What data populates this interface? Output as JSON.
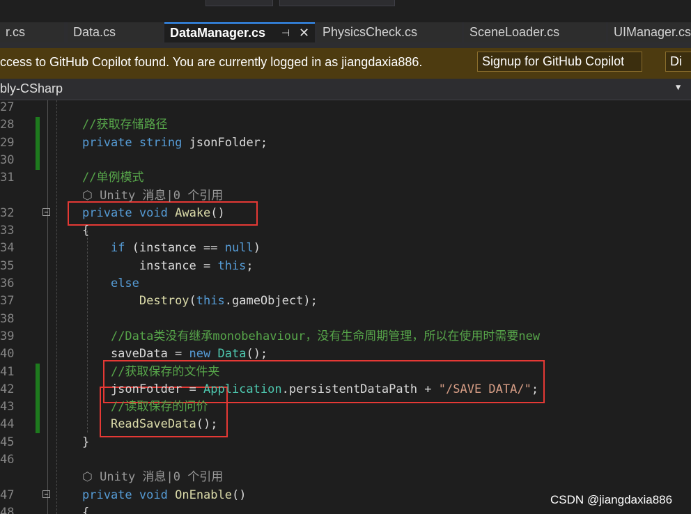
{
  "tabs": [
    {
      "label": "r.cs"
    },
    {
      "label": "Data.cs"
    },
    {
      "label": "DataManager.cs",
      "active": true
    },
    {
      "label": "PhysicsCheck.cs"
    },
    {
      "label": "SceneLoader.cs"
    },
    {
      "label": "UIManager.cs"
    }
  ],
  "tab_icons": {
    "pin": "⊣",
    "close": "✕"
  },
  "infobar": {
    "message": "ccess to GitHub Copilot found. You are currently logged in as jiangdaxia886.",
    "signup_button": "Signup for GitHub Copilot",
    "dismiss_button": "Di"
  },
  "navbar": {
    "project": "bly-CSharp",
    "dropdown_icon": "▼"
  },
  "code_lines": [
    {
      "n": "27",
      "segs": []
    },
    {
      "n": "28",
      "segs": [
        {
          "t": "//获取存储路径",
          "c": "cm"
        }
      ]
    },
    {
      "n": "29",
      "segs": [
        {
          "t": "private",
          "c": "kw"
        },
        {
          "t": " "
        },
        {
          "t": "string",
          "c": "kw"
        },
        {
          "t": " jsonFolder;"
        }
      ]
    },
    {
      "n": "30",
      "segs": []
    },
    {
      "n": "31",
      "segs": [
        {
          "t": "//单例模式",
          "c": "cm"
        }
      ]
    },
    {
      "n": "",
      "segs": [
        {
          "t": "⬡",
          "c": "hint"
        },
        {
          "t": " Unity 消息|0 个引用",
          "c": "hint"
        }
      ]
    },
    {
      "n": "32",
      "segs": [
        {
          "t": "private",
          "c": "kw"
        },
        {
          "t": " "
        },
        {
          "t": "void",
          "c": "kw"
        },
        {
          "t": " "
        },
        {
          "t": "Awake",
          "c": "fn"
        },
        {
          "t": "()"
        }
      ]
    },
    {
      "n": "33",
      "segs": [
        {
          "t": "{"
        }
      ]
    },
    {
      "n": "34",
      "segs": [
        {
          "t": "    "
        },
        {
          "t": "if",
          "c": "kw"
        },
        {
          "t": " (instance == "
        },
        {
          "t": "null",
          "c": "kw"
        },
        {
          "t": ")"
        }
      ]
    },
    {
      "n": "35",
      "segs": [
        {
          "t": "        instance = "
        },
        {
          "t": "this",
          "c": "kw"
        },
        {
          "t": ";"
        }
      ]
    },
    {
      "n": "36",
      "segs": [
        {
          "t": "    "
        },
        {
          "t": "else",
          "c": "kw"
        }
      ]
    },
    {
      "n": "37",
      "segs": [
        {
          "t": "        "
        },
        {
          "t": "Destroy",
          "c": "fn"
        },
        {
          "t": "("
        },
        {
          "t": "this",
          "c": "kw"
        },
        {
          "t": ".gameObject);"
        }
      ]
    },
    {
      "n": "38",
      "segs": []
    },
    {
      "n": "39",
      "segs": [
        {
          "t": "    "
        },
        {
          "t": "//Data类没有继承monobehaviour，没有生命周期管理，所以在使用时需要new",
          "c": "cm"
        }
      ]
    },
    {
      "n": "40",
      "segs": [
        {
          "t": "    saveData = "
        },
        {
          "t": "new",
          "c": "kw"
        },
        {
          "t": " "
        },
        {
          "t": "Data",
          "c": "ty"
        },
        {
          "t": "();"
        }
      ]
    },
    {
      "n": "41",
      "segs": [
        {
          "t": "    "
        },
        {
          "t": "//获取保存的文件夹",
          "c": "cm"
        }
      ]
    },
    {
      "n": "42",
      "segs": [
        {
          "t": "    jsonFolder = "
        },
        {
          "t": "Application",
          "c": "ty"
        },
        {
          "t": ".persistentDataPath + "
        },
        {
          "t": "\"/SAVE DATA/\"",
          "c": "st"
        },
        {
          "t": ";"
        }
      ]
    },
    {
      "n": "43",
      "segs": [
        {
          "t": "    "
        },
        {
          "t": "//读取保存的问价",
          "c": "cm"
        }
      ]
    },
    {
      "n": "44",
      "segs": [
        {
          "t": "    "
        },
        {
          "t": "ReadSaveData",
          "c": "fn"
        },
        {
          "t": "();"
        }
      ]
    },
    {
      "n": "45",
      "segs": [
        {
          "t": "}"
        }
      ]
    },
    {
      "n": "46",
      "segs": []
    },
    {
      "n": "",
      "segs": [
        {
          "t": "⬡",
          "c": "hint"
        },
        {
          "t": " Unity 消息|0 个引用",
          "c": "hint"
        }
      ]
    },
    {
      "n": "47",
      "segs": [
        {
          "t": "private",
          "c": "kw"
        },
        {
          "t": " "
        },
        {
          "t": "void",
          "c": "kw"
        },
        {
          "t": " "
        },
        {
          "t": "OnEnable",
          "c": "fn"
        },
        {
          "t": "()"
        }
      ]
    },
    {
      "n": "48",
      "segs": [
        {
          "t": "{"
        }
      ]
    }
  ],
  "watermark": "CSDN @jiangdaxia886"
}
